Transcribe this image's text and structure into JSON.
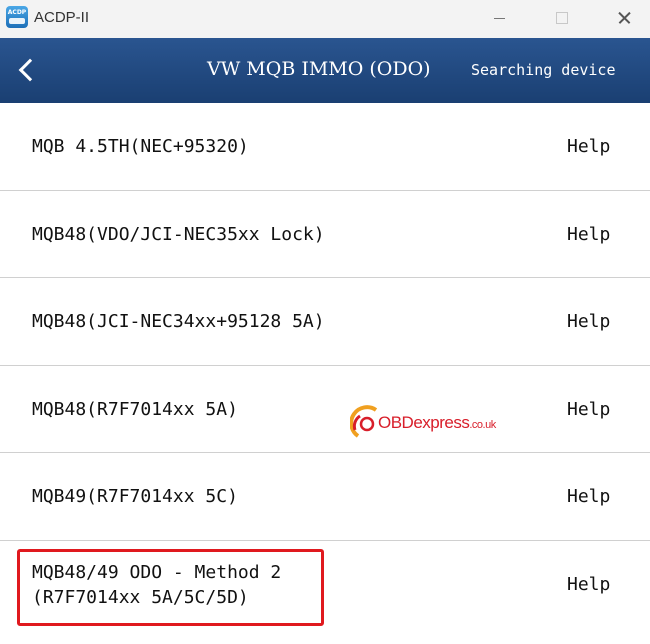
{
  "window": {
    "app_title": "ACDP-II",
    "app_icon_text": "ACDP"
  },
  "header": {
    "title": "VW MQB IMMO (ODO)",
    "status": "Searching device"
  },
  "list": {
    "items": [
      {
        "label": "MQB 4.5TH(NEC+95320)",
        "help": "Help"
      },
      {
        "label": "MQB48(VDO/JCI-NEC35xx Lock)",
        "help": "Help"
      },
      {
        "label": "MQB48(JCI-NEC34xx+95128 5A)",
        "help": "Help"
      },
      {
        "label": "MQB48(R7F7014xx 5A)",
        "help": "Help"
      },
      {
        "label": "MQB49(R7F7014xx 5C)",
        "help": "Help"
      },
      {
        "label": "MQB48/49 ODO - Method 2\n(R7F7014xx 5A/5C/5D)",
        "help": "Help"
      }
    ]
  },
  "watermark": {
    "brand": "OBDexpress",
    "suffix": ".co.uk"
  },
  "colors": {
    "header_top": "#2a5590",
    "header_bottom": "#1a3f72",
    "highlight": "#e0191e",
    "watermark": "#d81e2a"
  }
}
